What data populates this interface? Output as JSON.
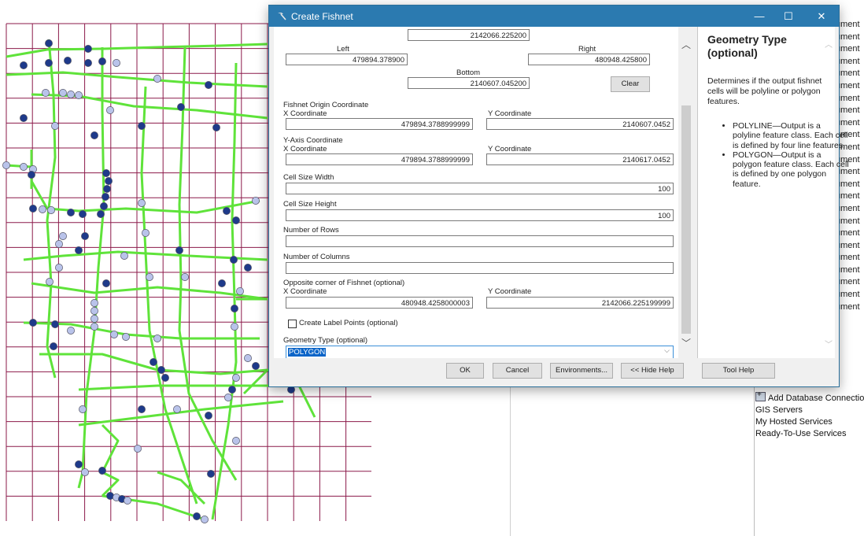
{
  "dialog": {
    "title": "Create Fishnet",
    "controls": {
      "minimize": "—",
      "maximize": "☐",
      "close": "✕"
    },
    "extent": {
      "top_value": "2142066.225200",
      "left_label": "Left",
      "left_value": "479894.378900",
      "right_label": "Right",
      "right_value": "480948.425800",
      "bottom_label": "Bottom",
      "bottom_value": "2140607.045200",
      "clear_label": "Clear"
    },
    "origin": {
      "label": "Fishnet Origin Coordinate",
      "x_label": "X Coordinate",
      "x_value": "479894.3788999999",
      "y_label": "Y Coordinate",
      "y_value": "2140607.0452"
    },
    "yaxis": {
      "label": "Y-Axis Coordinate",
      "x_label": "X Coordinate",
      "x_value": "479894.3788999999",
      "y_label": "Y Coordinate",
      "y_value": "2140617.0452"
    },
    "cell_width": {
      "label": "Cell Size Width",
      "value": "100"
    },
    "cell_height": {
      "label": "Cell Size Height",
      "value": "100"
    },
    "rows": {
      "label": "Number of Rows",
      "value": ""
    },
    "columns": {
      "label": "Number of Columns",
      "value": ""
    },
    "opposite": {
      "label": "Opposite corner of Fishnet (optional)",
      "x_label": "X Coordinate",
      "x_value": "480948.4258000003",
      "y_label": "Y Coordinate",
      "y_value": "2142066.225199999"
    },
    "label_points": {
      "label": "Create Label Points (optional)",
      "checked": false
    },
    "geometry": {
      "label": "Geometry Type (optional)",
      "value": "POLYGON"
    },
    "buttons": {
      "ok": "OK",
      "cancel": "Cancel",
      "environments": "Environments...",
      "hide_help": "<< Hide Help",
      "tool_help": "Tool Help"
    },
    "help": {
      "title": "Geometry Type (optional)",
      "description": "Determines if the output fishnet cells will be polyline or polygon features.",
      "bullets": [
        "POLYLINE—Output is a polyline feature class. Each cell is defined by four line features.",
        "POLYGON—Output is a polygon feature class. Each cell is defined by one polygon feature."
      ]
    }
  },
  "catalog": {
    "truncated_items": [
      "ument",
      "ument",
      "ument",
      "ument",
      "ument",
      "ument",
      "ument",
      "ument",
      "ument",
      "ument",
      "ument",
      "ument",
      "ument",
      "ument",
      "ument",
      "ument",
      "ument",
      "ument",
      "ument",
      "ument",
      "ument",
      "ument",
      "ument",
      "ument"
    ],
    "tree": [
      {
        "label": "Add Database Connectio",
        "icon": "database-add-icon"
      },
      {
        "label": "GIS Servers"
      },
      {
        "label": "My Hosted Services"
      },
      {
        "label": "Ready-To-Use Services"
      }
    ]
  },
  "map": {
    "grid_color": "#8b1a4a",
    "road_color": "#5fe33a",
    "point_dark": "#1e3a8a",
    "point_light": "#b9c3ea"
  }
}
